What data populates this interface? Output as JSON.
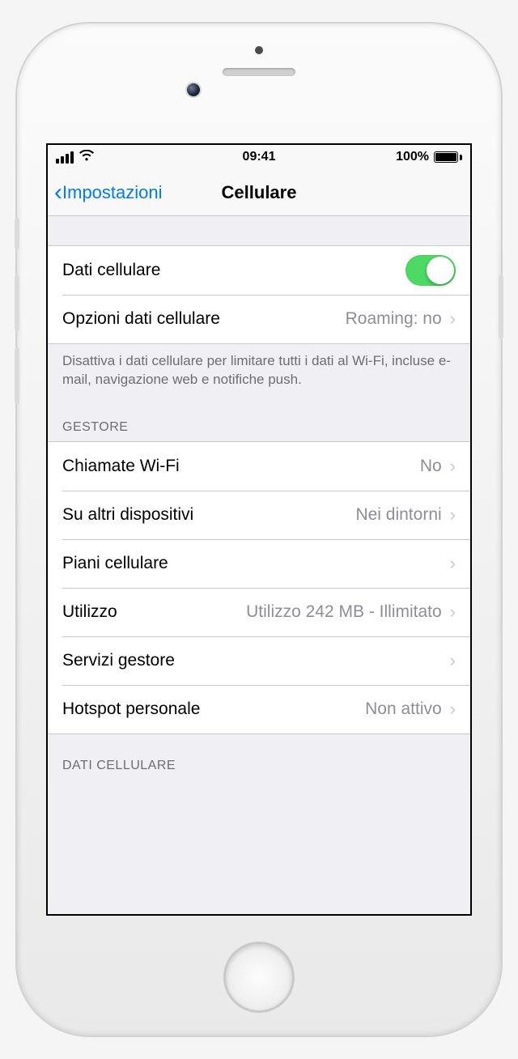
{
  "status": {
    "time": "09:41",
    "battery_pct": "100%"
  },
  "nav": {
    "back_label": "Impostazioni",
    "title": "Cellulare"
  },
  "main_group": {
    "cellular_data_label": "Dati cellulare",
    "options_label": "Opzioni dati cellulare",
    "options_value": "Roaming: no"
  },
  "footer1": "Disattiva i dati cellulare per limitare tutti i dati al Wi-Fi, incluse e-mail, navigazione web e notifiche push.",
  "carrier_header": "GESTORE",
  "carrier_group": {
    "wifi_calling_label": "Chiamate Wi-Fi",
    "wifi_calling_value": "No",
    "other_devices_label": "Su altri dispositivi",
    "other_devices_value": "Nei dintorni",
    "plans_label": "Piani cellulare",
    "usage_label": "Utilizzo",
    "usage_value": "Utilizzo 242 MB - Illimitato",
    "carrier_services_label": "Servizi gestore",
    "hotspot_label": "Hotspot personale",
    "hotspot_value": "Non attivo"
  },
  "data_header": "DATI CELLULARE"
}
